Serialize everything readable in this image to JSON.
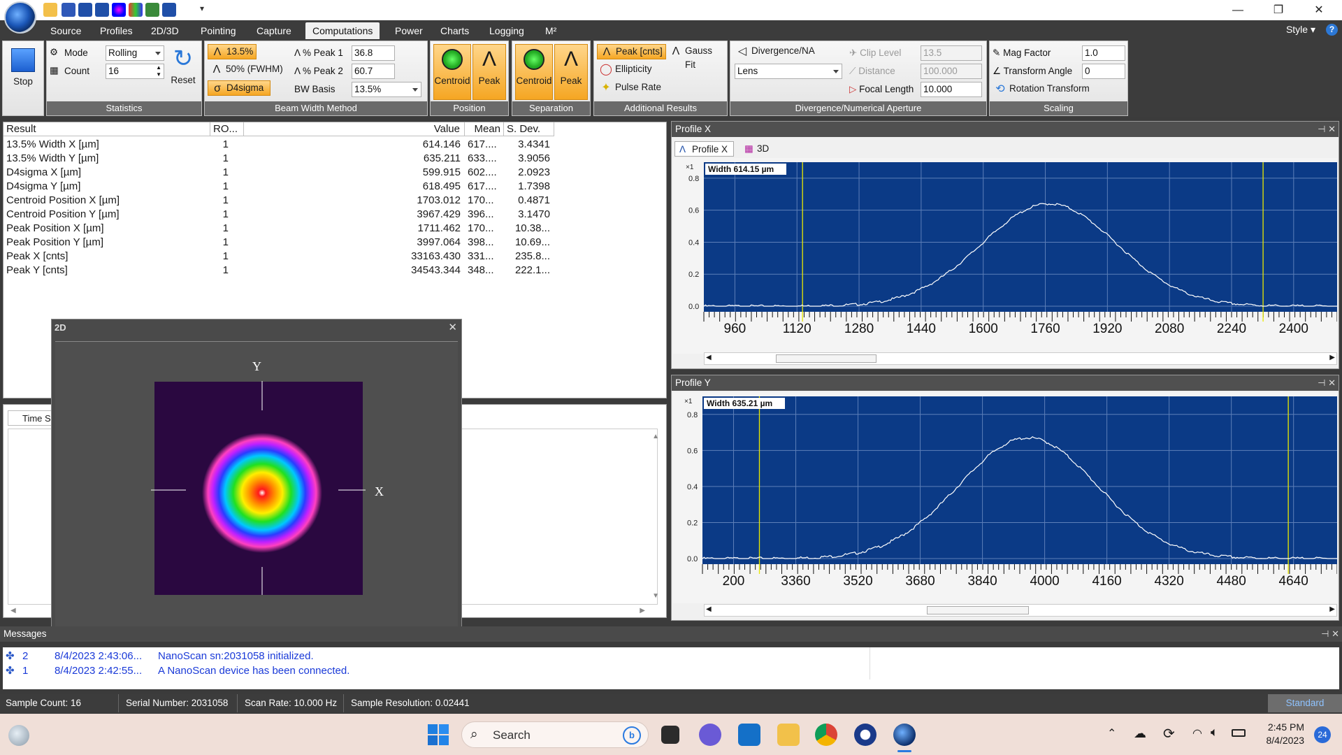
{
  "title_bar": {
    "quick_access": [
      "open-folder-icon",
      "save-icon",
      "profile-icon",
      "profile-x-icon",
      "spectrum-icon",
      "bars-icon",
      "grid-icon",
      "profile-a-icon"
    ]
  },
  "menu": {
    "tabs": [
      "Source",
      "Profiles",
      "2D/3D",
      "Pointing",
      "Capture",
      "Computations",
      "Power",
      "Charts",
      "Logging",
      "M²"
    ],
    "active": "Computations",
    "style": "Style"
  },
  "ribbon": {
    "stop": "Stop",
    "mode_label": "Mode",
    "mode_value": "Rolling",
    "count_label": "Count",
    "count_value": "16",
    "reset": "Reset",
    "statistics": "Statistics",
    "bw_135": "13.5%",
    "bw_fwhm": "50% (FWHM)",
    "bw_d4": "D4sigma",
    "peak1_label": "% Peak 1",
    "peak1_value": "36.8",
    "peak2_label": "% Peak 2",
    "peak2_value": "60.7",
    "bw_basis_label": "BW Basis",
    "bw_basis_value": "13.5%",
    "beam_width_method": "Beam Width Method",
    "pos_centroid": "Centroid",
    "pos_peak": "Peak",
    "position": "Position",
    "sep_centroid": "Centroid",
    "sep_peak": "Peak",
    "separation": "Separation",
    "peak_cnts": "Peak [cnts]",
    "gauss_fit": "Gauss Fit",
    "ellipticity": "Ellipticity",
    "pulse_rate": "Pulse Rate",
    "additional_results": "Additional Results",
    "divergence": "Divergence/NA",
    "lens": "Lens",
    "clip_level_label": "Clip Level",
    "clip_level_value": "13.5",
    "distance_label": "Distance",
    "distance_value": "100.000",
    "focal_length_label": "Focal Length",
    "focal_length_value": "10.000",
    "div_na": "Divergence/Numerical Aperture",
    "mag_factor_label": "Mag Factor",
    "mag_factor_value": "1.0",
    "transform_angle_label": "Transform Angle",
    "transform_angle_value": "0",
    "rotation_transform": "Rotation Transform",
    "scaling": "Scaling"
  },
  "results": {
    "headers": [
      "Result",
      "RO...",
      "Value",
      "Mean",
      "S. Dev."
    ],
    "rows": [
      [
        "13.5% Width X [µm]",
        "1",
        "614.146",
        "617....",
        "3.4341"
      ],
      [
        "13.5% Width Y [µm]",
        "1",
        "635.211",
        "633....",
        "3.9056"
      ],
      [
        "D4sigma X [µm]",
        "1",
        "599.915",
        "602....",
        "2.0923"
      ],
      [
        "D4sigma Y [µm]",
        "1",
        "618.495",
        "617....",
        "1.7398"
      ],
      [
        "Centroid Position X [µm]",
        "1",
        "1703.012",
        "170...",
        "0.4871"
      ],
      [
        "Centroid Position Y [µm]",
        "1",
        "3967.429",
        "396...",
        "3.1470"
      ],
      [
        "Peak Position X [µm]",
        "1",
        "1711.462",
        "170...",
        "10.38..."
      ],
      [
        "Peak Position Y [µm]",
        "1",
        "3997.064",
        "398...",
        "10.69..."
      ],
      [
        "Peak X [cnts]",
        "1",
        "33163.430",
        "331...",
        "235.8..."
      ],
      [
        "Peak Y [cnts]",
        "1",
        "34543.344",
        "348...",
        "222.1..."
      ]
    ]
  },
  "time_panel": {
    "col": "Time St"
  },
  "win2d": {
    "title": "2D",
    "x_label": "X",
    "y_label": "Y"
  },
  "profile_x": {
    "panel_title": "Profile X",
    "tab1": "Profile X",
    "tab2": "3D",
    "scale": "×1",
    "width_label": "Width 614.15 µm",
    "y_ticks": [
      "0.8",
      "0.6",
      "0.4",
      "0.2",
      "0.0"
    ],
    "x_ticks": [
      "960",
      "1120",
      "1280",
      "1440",
      "1600",
      "1760",
      "1920",
      "2080",
      "2240",
      "2400"
    ],
    "x_range": [
      880,
      2420
    ],
    "center": 1720,
    "sigma": 165,
    "peak": 0.64,
    "clip_lines": [
      1120,
      2240
    ]
  },
  "profile_y": {
    "panel_title": "Profile Y",
    "scale": "×1",
    "width_label": "Width 635.21 µm",
    "y_ticks": [
      "0.8",
      "0.6",
      "0.4",
      "0.2",
      "0.0"
    ],
    "x_ticks": [
      "200",
      "3360",
      "3520",
      "3680",
      "3840",
      "4000",
      "4160",
      "4320",
      "4480",
      "4640"
    ],
    "x_range": [
      3200,
      4760
    ],
    "center": 4000,
    "sigma": 170,
    "peak": 0.67,
    "clip_lines": [
      3340,
      4640
    ]
  },
  "messages": {
    "title": "Messages",
    "rows": [
      {
        "id": "2",
        "time": "8/4/2023 2:43:06...",
        "text": "NanoScan sn:2031058 initialized."
      },
      {
        "id": "1",
        "time": "8/4/2023 2:42:55...",
        "text": "A NanoScan device has been connected."
      }
    ]
  },
  "status": {
    "sample_count": "Sample Count: 16",
    "serial": "Serial Number: 2031058",
    "scan_rate": "Scan Rate: 10.000 Hz",
    "resolution": "Sample Resolution: 0.02441",
    "mode": "Standard"
  },
  "taskbar": {
    "search": "Search",
    "time": "2:45 PM",
    "date": "8/4/2023",
    "badge": "24"
  },
  "colors": {
    "plot_bg": "#0b3a86",
    "accent": "#f5a623",
    "message_text": "#1a3ad8"
  }
}
